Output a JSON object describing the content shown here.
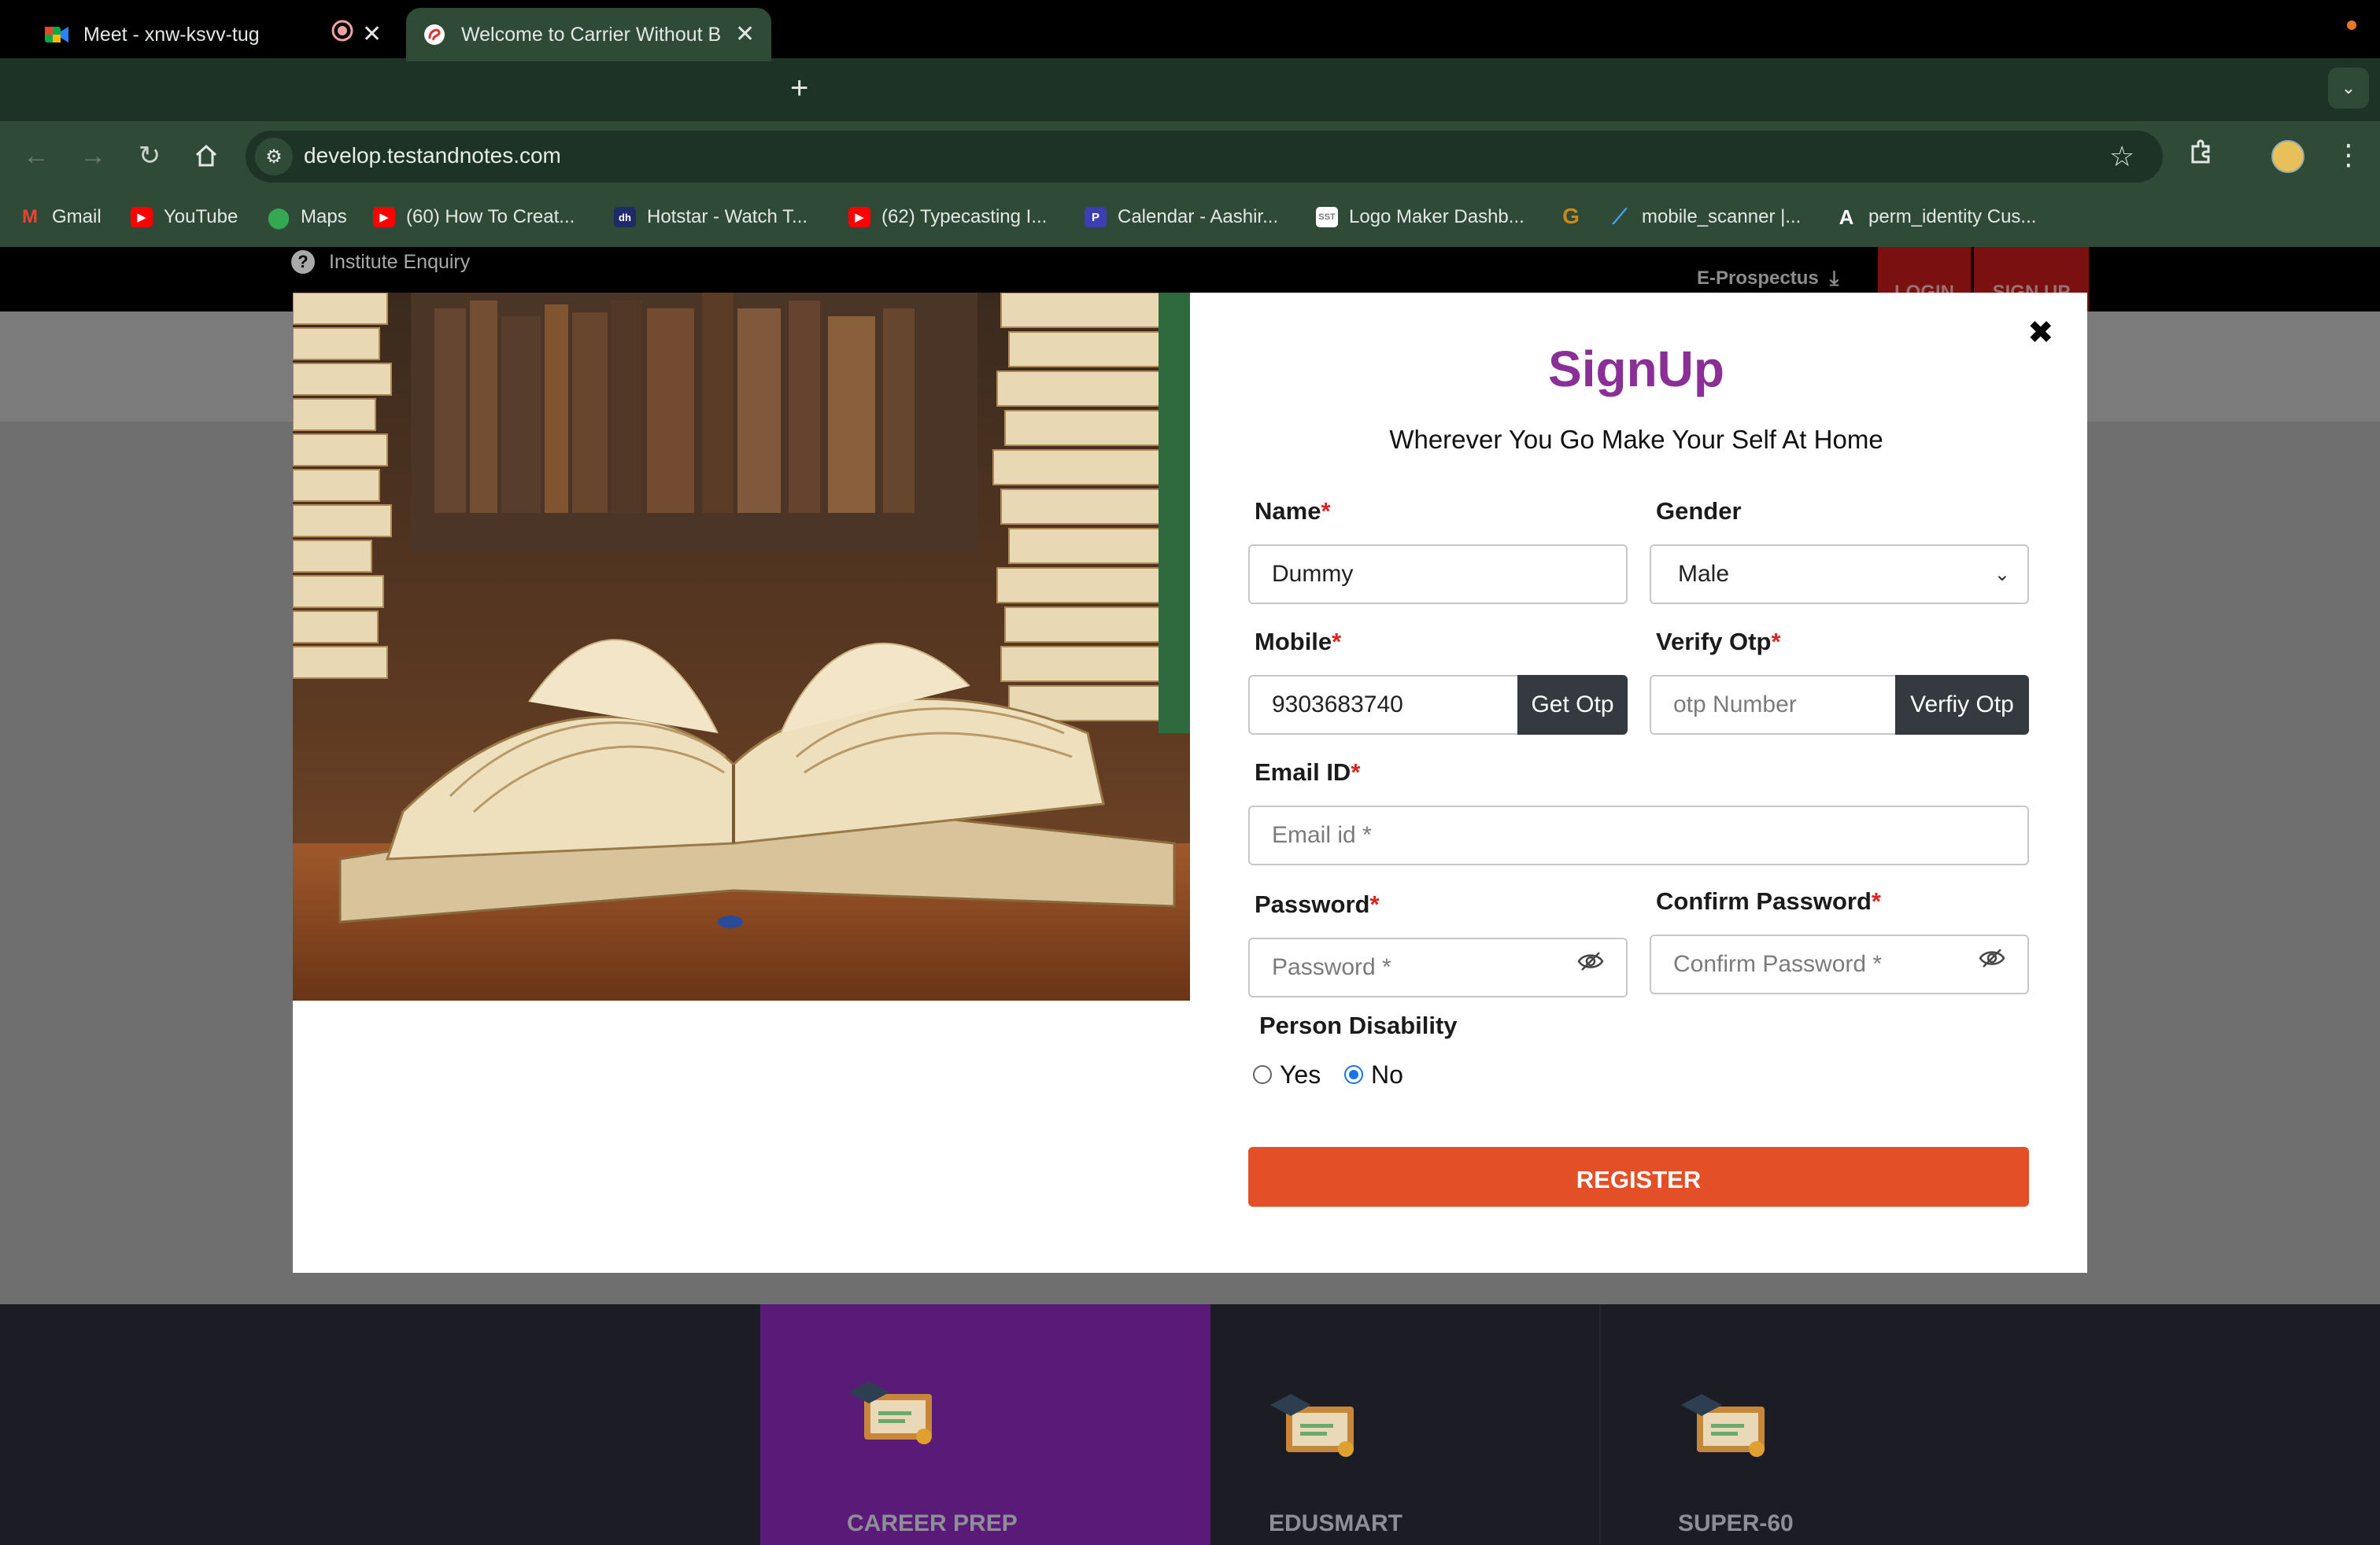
{
  "browser": {
    "tabs": [
      {
        "title": "Meet - xnw-ksvv-tug",
        "icon": "google-meet-icon"
      },
      {
        "title": "Welcome to Carrier Without B",
        "icon": "site-favicon"
      }
    ],
    "url": "develop.testandnotes.com",
    "bookmarks": [
      {
        "label": "Gmail",
        "icon": "gmail-icon",
        "color": "#ea4335"
      },
      {
        "label": "YouTube",
        "icon": "youtube-icon",
        "color": "#ff0000"
      },
      {
        "label": "Maps",
        "icon": "maps-icon",
        "color": "#34a853"
      },
      {
        "label": "(60) How To Creat...",
        "icon": "youtube-icon",
        "color": "#ff0000"
      },
      {
        "label": "Hotstar - Watch T...",
        "icon": "hotstar-icon",
        "color": "#1f2a68"
      },
      {
        "label": "(62) Typecasting I...",
        "icon": "youtube-icon",
        "color": "#ff0000"
      },
      {
        "label": "Calendar - Aashir...",
        "icon": "calendar-icon",
        "color": "#3b3fb3"
      },
      {
        "label": "Logo Maker Dashb...",
        "icon": "logo-maker-icon",
        "color": "#ffffff"
      },
      {
        "label": "",
        "icon": "g-icon",
        "color": "#c68a1a"
      },
      {
        "label": "mobile_scanner |...",
        "icon": "flutter-icon",
        "color": "#42a5f5"
      },
      {
        "label": "perm_identity Cus...",
        "icon": "angular-icon",
        "color": "#000000"
      }
    ]
  },
  "site": {
    "enquiry": "Institute Enquiry",
    "eprospectus": "E-Prospectus",
    "login": "LOGIN",
    "signup": "SIGN UP",
    "cards": [
      "CAREER PREP",
      "EDUSMART",
      "SUPER-60"
    ]
  },
  "modal": {
    "title": "SignUp",
    "subtitle": "Wherever You Go Make Your Self At Home",
    "name_label": "Name",
    "name_value": "Dummy",
    "gender_label": "Gender",
    "gender_value": "Male",
    "mobile_label": "Mobile",
    "mobile_value": "9303683740",
    "get_otp": "Get Otp",
    "otp_label": "Verify Otp",
    "otp_placeholder": "otp Number",
    "verify_otp": "Verfiy Otp",
    "email_label": "Email ID",
    "email_placeholder": "Email id *",
    "password_label": "Password",
    "password_placeholder": "Password *",
    "confirm_label": "Confirm Password",
    "confirm_placeholder": "Confirm Password *",
    "disability_label": "Person Disability",
    "yes": "Yes",
    "no": "No",
    "disability_selected": "No",
    "register": "REGISTER",
    "required_mark": "*"
  },
  "colors": {
    "title": "#8a2f96",
    "register": "#e34f27",
    "otp_button": "#343a40",
    "career_card": "#5a1a78"
  }
}
